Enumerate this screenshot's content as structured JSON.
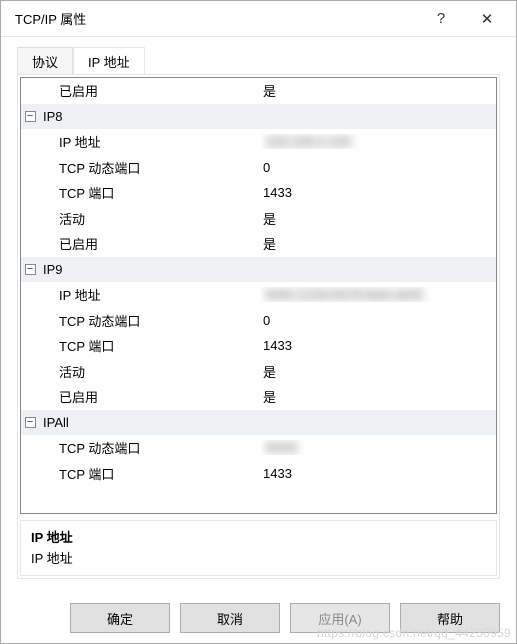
{
  "window": {
    "title": "TCP/IP 属性",
    "help_glyph": "?",
    "close_glyph": "✕"
  },
  "tabs": {
    "protocol": "协议",
    "ip": "IP 地址"
  },
  "grid": {
    "rows": [
      {
        "type": "prop",
        "label": "已启用",
        "value": "是",
        "blurred": false
      },
      {
        "type": "category",
        "label": "IP8"
      },
      {
        "type": "prop",
        "label": "IP 地址",
        "value": "192.168.1.100",
        "blurred": true
      },
      {
        "type": "prop",
        "label": "TCP 动态端口",
        "value": "0",
        "blurred": false
      },
      {
        "type": "prop",
        "label": "TCP 端口",
        "value": "1433",
        "blurred": false
      },
      {
        "type": "prop",
        "label": "活动",
        "value": "是",
        "blurred": false
      },
      {
        "type": "prop",
        "label": "已启用",
        "value": "是",
        "blurred": false
      },
      {
        "type": "category",
        "label": "IP9"
      },
      {
        "type": "prop",
        "label": "IP 地址",
        "value": "fe80::1234:5678:9abc:def0",
        "blurred": true
      },
      {
        "type": "prop",
        "label": "TCP 动态端口",
        "value": "0",
        "blurred": false
      },
      {
        "type": "prop",
        "label": "TCP 端口",
        "value": "1433",
        "blurred": false
      },
      {
        "type": "prop",
        "label": "活动",
        "value": "是",
        "blurred": false
      },
      {
        "type": "prop",
        "label": "已启用",
        "value": "是",
        "blurred": false
      },
      {
        "type": "category",
        "label": "IPAll"
      },
      {
        "type": "prop",
        "label": "TCP 动态端口",
        "value": "0000",
        "blurred": true
      },
      {
        "type": "prop",
        "label": "TCP 端口",
        "value": "1433",
        "blurred": false
      }
    ]
  },
  "description": {
    "title": "IP 地址",
    "body": "IP 地址"
  },
  "buttons": {
    "ok": "确定",
    "cancel": "取消",
    "apply": "应用(A)",
    "help": "帮助"
  },
  "watermark": "https://blog.csdn.net/qq_44230959"
}
